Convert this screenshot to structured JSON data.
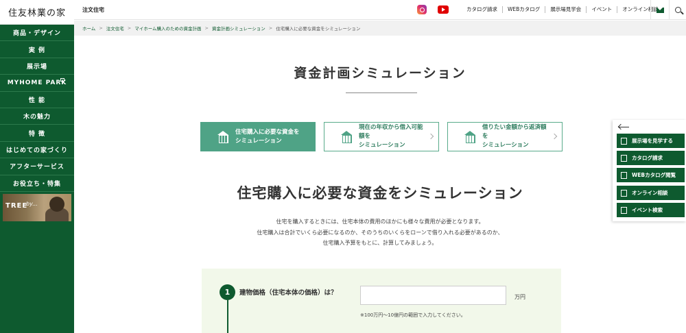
{
  "brand": {
    "name": "住友林業の家"
  },
  "sidebar": {
    "items": [
      {
        "label": "商品・デザイン"
      },
      {
        "label": "実 例"
      },
      {
        "label": "展示場"
      },
      {
        "label": "MYHOME PARK"
      },
      {
        "label": "性 能"
      },
      {
        "label": "木の魅力"
      },
      {
        "label": "特 徴"
      },
      {
        "label": "はじめての家づくり"
      },
      {
        "label": "アフターサービス"
      },
      {
        "label": "お役立ち・特集"
      }
    ],
    "banner": {
      "text": "TREE",
      "script": "by..."
    }
  },
  "header": {
    "section": "注文住宅",
    "links": [
      {
        "label": "カタログ請求"
      },
      {
        "label": "WEBカタログ"
      },
      {
        "label": "展示場見学会"
      },
      {
        "label": "イベント"
      },
      {
        "label": "オンライン相談"
      }
    ]
  },
  "breadcrumb": [
    {
      "label": "ホーム"
    },
    {
      "label": "注文住宅"
    },
    {
      "label": "マイホーム購入のための資金計画"
    },
    {
      "label": "資金計画シミュレーション"
    },
    {
      "label": "住宅購入に必要な資金をシミュレーション"
    }
  ],
  "page": {
    "title": "資金計画シミュレーション",
    "tabs": [
      {
        "line1": "住宅購入に必要な資金を",
        "line2": "シミュレーション",
        "active": true
      },
      {
        "line1": "現在の年収から借入可能額を",
        "line2": "シミュレーション",
        "active": false
      },
      {
        "line1": "借りたい金額から返済額を",
        "line2": "シミュレーション",
        "active": false
      }
    ],
    "section_heading": "住宅購入に必要な資金をシミュレーション",
    "intro": [
      "住宅を購入するときには、住宅本体の費用のほかにも様々な費用が必要となります。",
      "住宅購入は合計でいくら必要になるのか、そのうちのいくらをローンで借り入れる必要があるのか、",
      "住宅購入予算をもとに、計算してみましょう。"
    ]
  },
  "form": {
    "step_number": "1",
    "label": "建物価格（住宅本体の価格）は？",
    "value": "",
    "placeholder": "",
    "unit": "万円",
    "note": "※100万円〜10億円の範囲で入力してください。"
  },
  "side_panel": {
    "buttons": [
      {
        "label": "展示場を見学する"
      },
      {
        "label": "カタログ請求"
      },
      {
        "label": "WEBカタログ閲覧"
      },
      {
        "label": "オンライン相談"
      },
      {
        "label": "イベント検索"
      }
    ]
  },
  "colors": {
    "brand_green": "#0e5a2f",
    "accent_green": "#4fa386",
    "form_bg": "#f2f8ea"
  }
}
